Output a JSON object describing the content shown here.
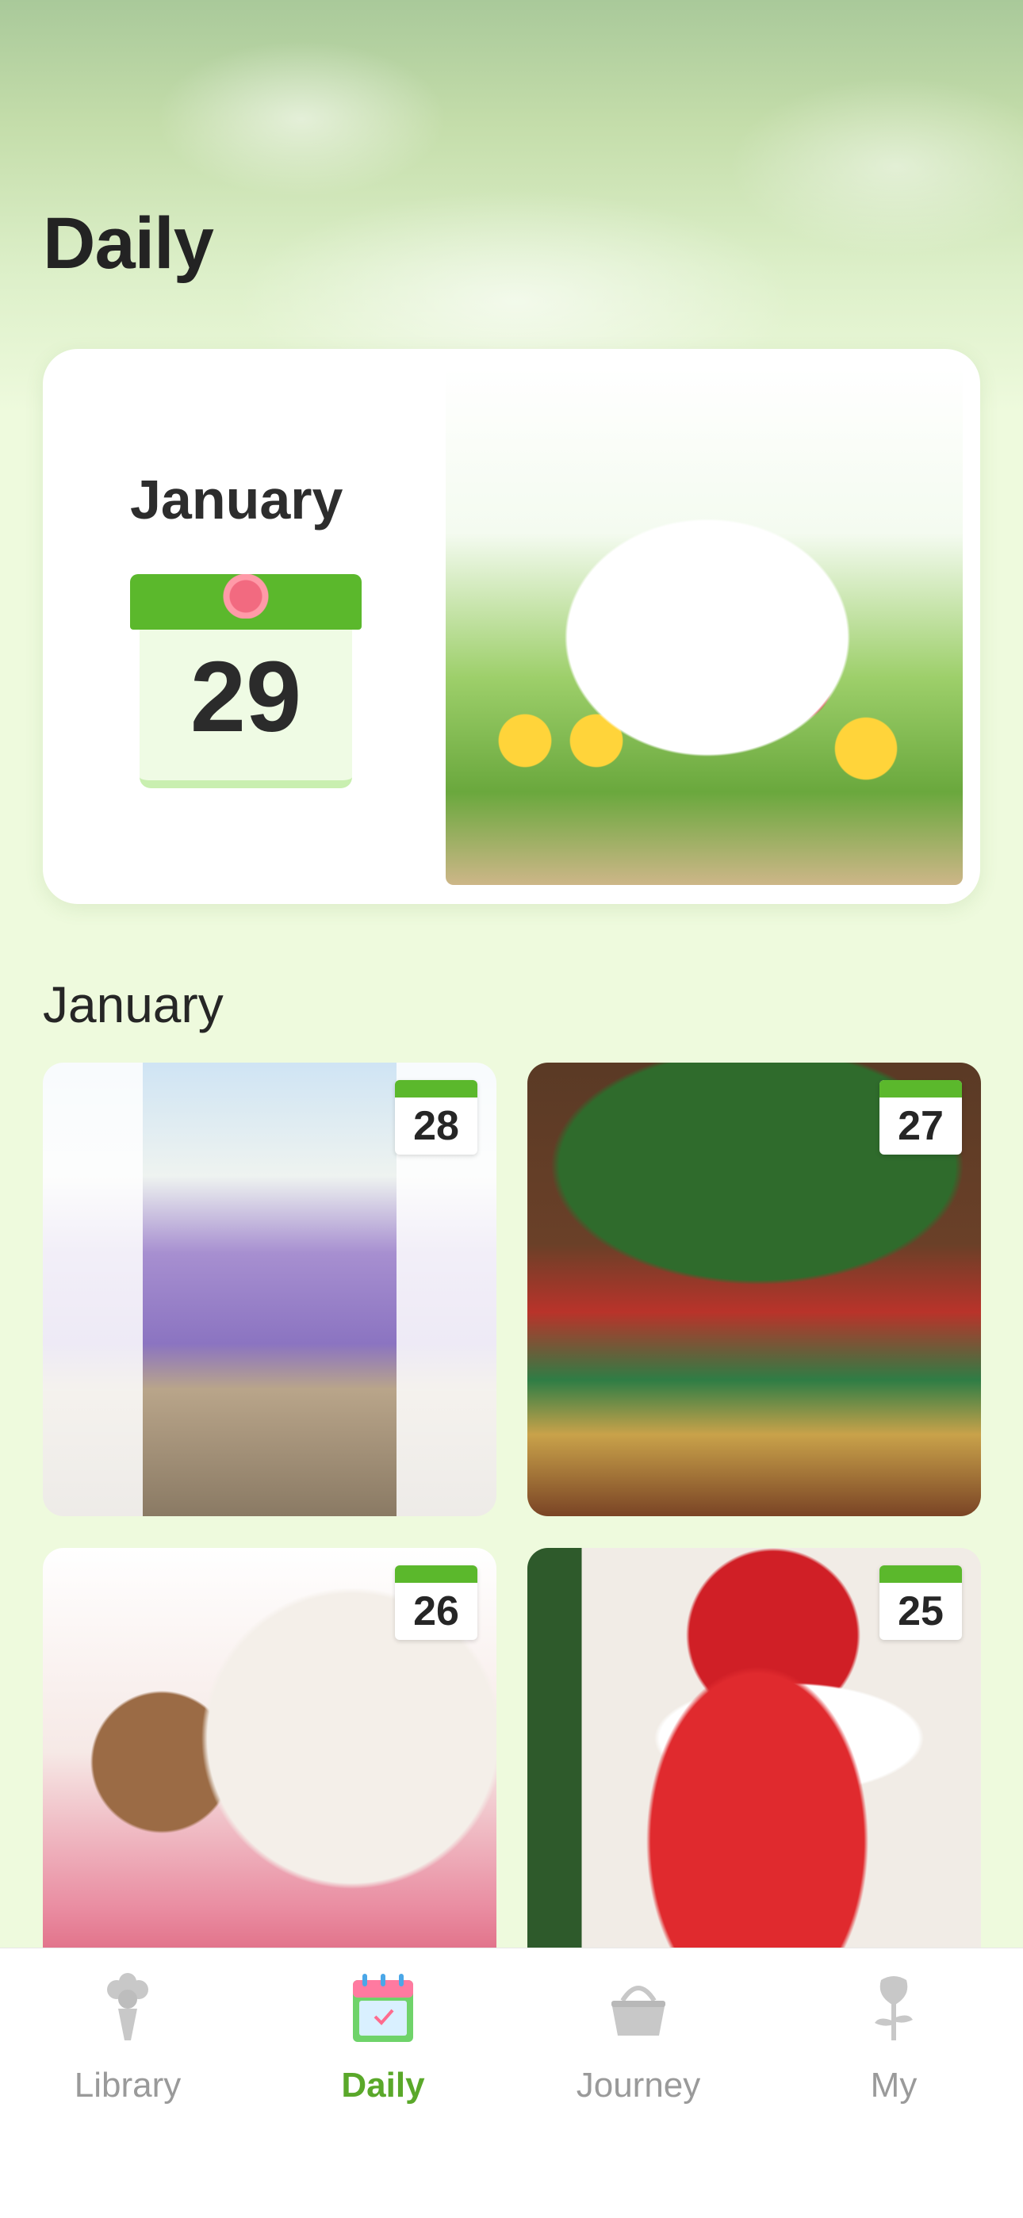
{
  "header": {
    "title": "Daily"
  },
  "featured": {
    "month": "January",
    "day": "29"
  },
  "section": {
    "title": "January"
  },
  "tiles": [
    {
      "day": "28"
    },
    {
      "day": "27"
    },
    {
      "day": "26"
    },
    {
      "day": "25"
    }
  ],
  "tab_bar": {
    "items": [
      {
        "label": "Library",
        "icon": "bouquet-icon",
        "active": false
      },
      {
        "label": "Daily",
        "icon": "calendar-icon",
        "active": true
      },
      {
        "label": "Journey",
        "icon": "basket-icon",
        "active": false
      },
      {
        "label": "My",
        "icon": "rose-icon",
        "active": false
      }
    ]
  },
  "colors": {
    "accent_green": "#5bb82c",
    "active_tab_text": "#5aa82a",
    "inactive_tab_text": "#9a9a9a"
  }
}
